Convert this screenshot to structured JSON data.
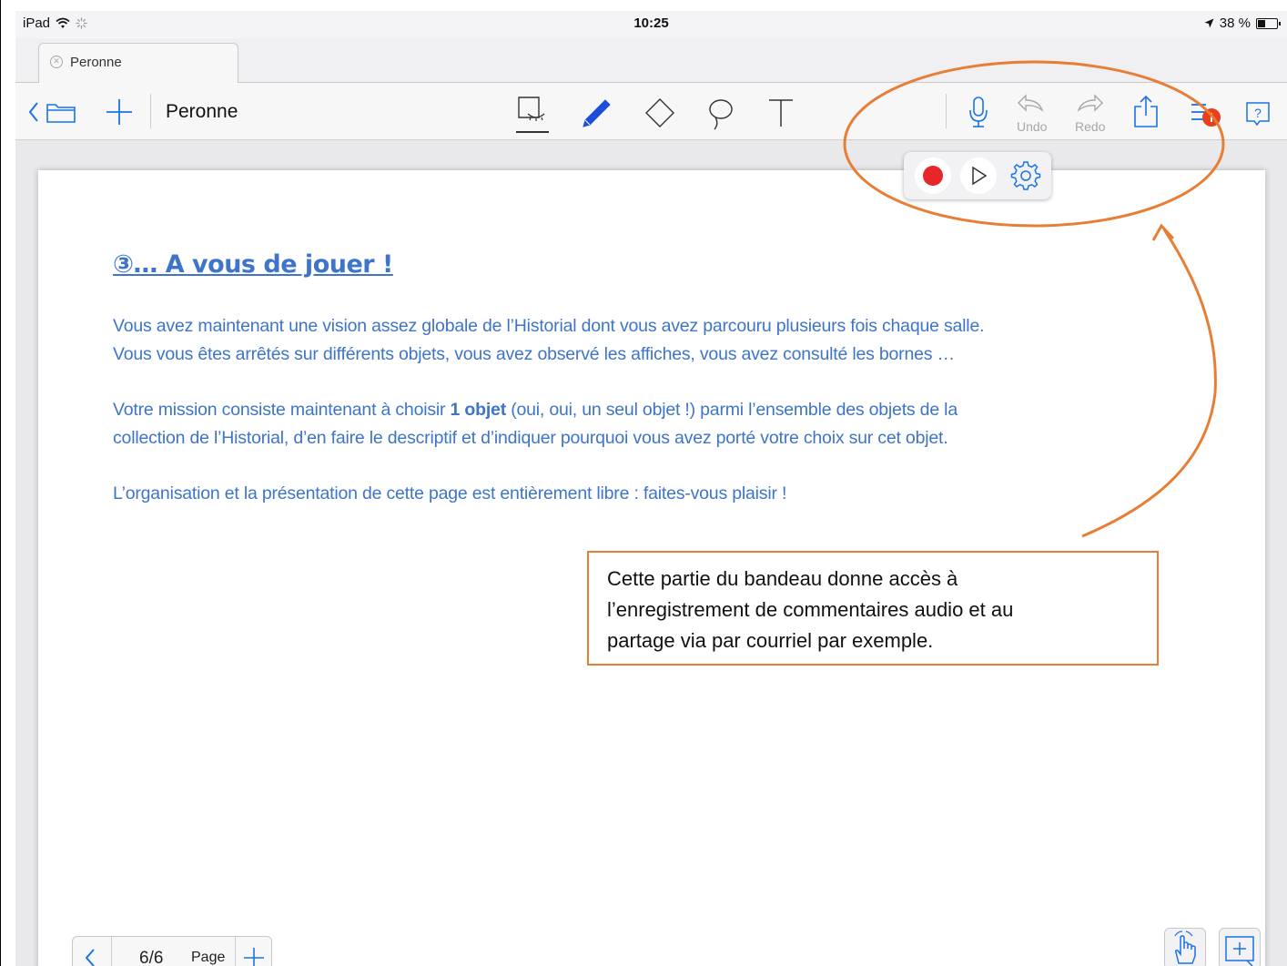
{
  "status_bar": {
    "device": "iPad",
    "time": "10:25",
    "battery": "38 %",
    "battery_level": 0.38
  },
  "tab": {
    "label": "Peronne"
  },
  "toolbar": {
    "document_title": "Peronne",
    "undo_label": "Undo",
    "redo_label": "Redo",
    "accent_color": "#1a73e8",
    "badge_color": "#e8401c"
  },
  "record_popup": {
    "record_color": "#e8262a"
  },
  "page": {
    "heading": "③… A vous de jouer !",
    "paragraph1_line1": "Vous avez maintenant une vision assez globale de l’Historial dont vous avez parcouru plusieurs fois chaque salle.",
    "paragraph1_line2": "Vous vous êtes arrêtés sur différents objets, vous avez observé les affiches, vous avez consulté les bornes …",
    "paragraph2_line1_before": "Votre mission consiste maintenant à choisir ",
    "paragraph2_line1_bold": "1 objet",
    "paragraph2_line1_after": " (oui, oui, un seul objet !) parmi l’ensemble des objets de la",
    "paragraph2_line2": "collection de l’Historial, d’en faire le descriptif et d’indiquer pourquoi vous avez porté votre choix sur cet objet.",
    "paragraph3": "L’organisation et la présentation de cette page est entièrement libre : faites-vous plaisir !",
    "text_color": "#3e74c9"
  },
  "annotation": {
    "callout_line1": "Cette partie du bandeau donne accès à",
    "callout_line2": "l’enregistrement de commentaires audio et au",
    "callout_line3": "partage via par courriel par exemple.",
    "color": "#e87e35"
  },
  "pager": {
    "count": "6/6",
    "label": "Page"
  }
}
